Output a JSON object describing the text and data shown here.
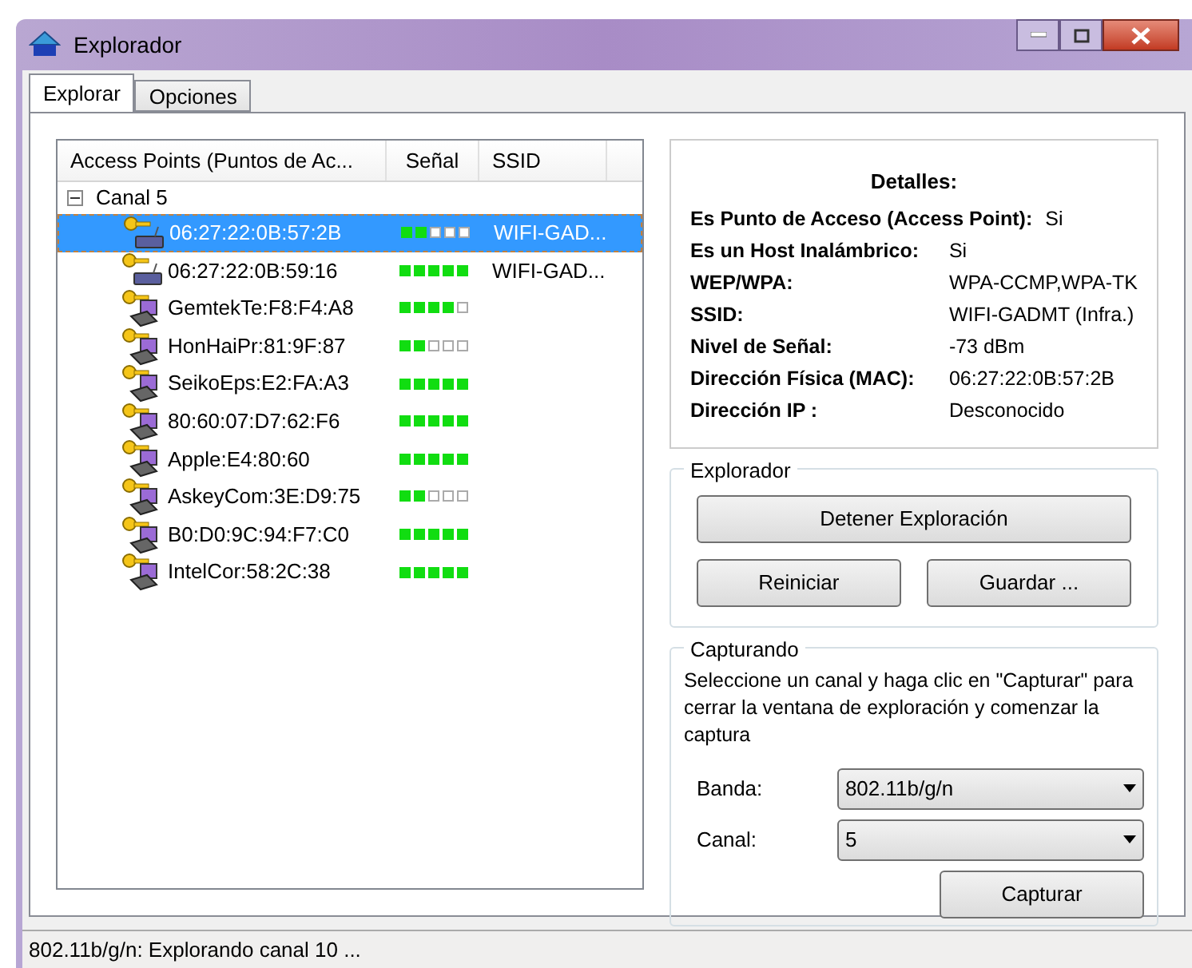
{
  "window": {
    "title": "Explorador"
  },
  "tabs": [
    {
      "label": "Explorar",
      "selected": true
    },
    {
      "label": "Opciones",
      "selected": false
    }
  ],
  "list": {
    "columns": [
      "Access Points (Puntos de Ac...",
      "Señal",
      "SSID"
    ],
    "groups": [
      {
        "label": "Canal 5",
        "expanded": true,
        "children": [
          {
            "kind": "router",
            "mac": "06:27:22:0B:57:2B",
            "stars": 2,
            "ssid": "WIFI-GAD...",
            "selected": true
          },
          {
            "kind": "router",
            "mac": "06:27:22:0B:59:16",
            "stars": 5,
            "ssid": "WIFI-GAD...",
            "selected": false
          },
          {
            "kind": "station",
            "mac": "GemtekTe:F8:F4:A8",
            "stars": 4,
            "selected": false
          },
          {
            "kind": "station",
            "mac": "HonHaiPr:81:9F:87",
            "stars": 2,
            "selected": false
          },
          {
            "kind": "station",
            "mac": "SeikoEps:E2:FA:A3",
            "stars": 5,
            "selected": false
          },
          {
            "kind": "station",
            "mac": "80:60:07:D7:62:F6",
            "stars": 5,
            "selected": false
          },
          {
            "kind": "station",
            "mac": "Apple:E4:80:60",
            "stars": 5,
            "selected": false
          },
          {
            "kind": "station",
            "mac": "AskeyCom:3E:D9:75",
            "stars": 2,
            "selected": false
          },
          {
            "kind": "station",
            "mac": "B0:D0:9C:94:F7:C0",
            "stars": 5,
            "selected": false
          },
          {
            "kind": "station",
            "mac": "IntelCor:58:2C:38",
            "stars": 5,
            "selected": false
          }
        ]
      }
    ]
  },
  "details": {
    "title": "Detalles:",
    "rows": [
      {
        "label": "Es Punto de Acceso (Access Point):",
        "value": "Si"
      },
      {
        "label": "Es un Host Inalámbrico:",
        "value": "Si"
      },
      {
        "label": "WEP/WPA:",
        "value": "WPA-CCMP,WPA-TK"
      },
      {
        "label": "SSID:",
        "value": "WIFI-GADMT (Infra.)"
      },
      {
        "label": "Nivel de Señal:",
        "value": "-73 dBm"
      },
      {
        "label": "Dirección Física (MAC):",
        "value": "06:27:22:0B:57:2B"
      },
      {
        "label": "Dirección IP :",
        "value": "Desconocido"
      }
    ]
  },
  "explorer_group": {
    "title": "Explorador",
    "buttons": [
      "Detener Exploración",
      "Reiniciar",
      "Guardar ..."
    ]
  },
  "capture_group": {
    "title": "Capturando",
    "instructions": "Seleccione un canal y haga clic en \"Capturar\" para cerrar la ventana de exploración y comenzar la captura",
    "fields": [
      {
        "label": "Banda:",
        "value": "802.11b/g/n"
      },
      {
        "label": "Canal:",
        "value": "5"
      }
    ],
    "button": "Capturar"
  },
  "status_bar": "802.11b/g/n: Explorando canal 10 ..."
}
